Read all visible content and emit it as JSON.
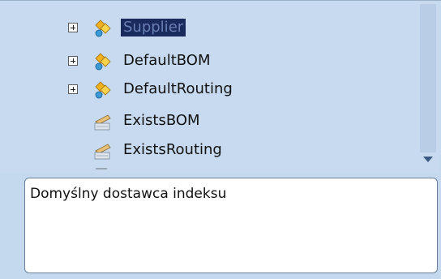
{
  "tree": {
    "items": [
      {
        "label": "Supplier",
        "expandable": true,
        "icon": "property-group-icon",
        "selected": true
      },
      {
        "label": "DefaultBOM",
        "expandable": true,
        "icon": "property-group-icon",
        "selected": false
      },
      {
        "label": "DefaultRouting",
        "expandable": true,
        "icon": "property-group-icon",
        "selected": false
      },
      {
        "label": "ExistsBOM",
        "expandable": false,
        "icon": "method-icon",
        "selected": false
      },
      {
        "label": "ExistsRouting",
        "expandable": false,
        "icon": "method-icon",
        "selected": false
      }
    ]
  },
  "description": {
    "text": "Domyślny dostawca indeksu"
  },
  "colors": {
    "panel_background": "#c7daf0",
    "selection_background": "#1a2a5c",
    "selection_text": "#6a7fb5"
  }
}
